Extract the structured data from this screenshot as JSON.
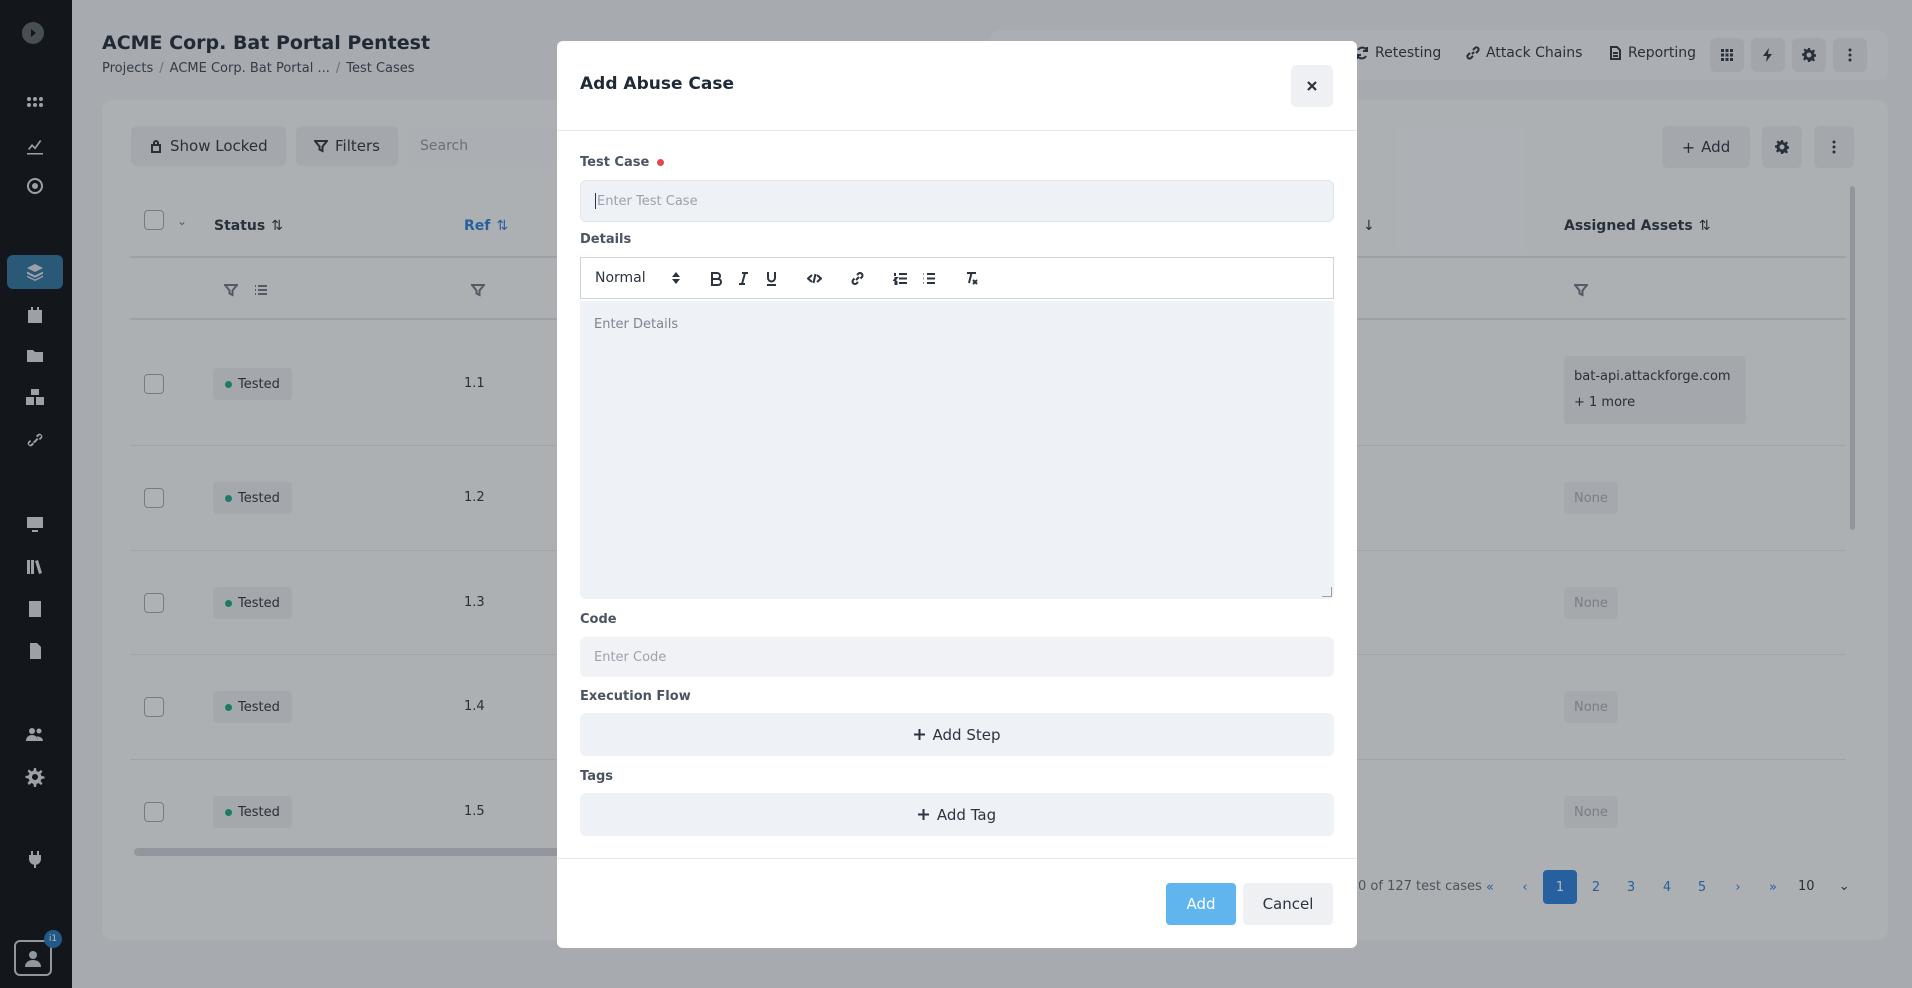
{
  "page": {
    "title": "ACME Corp. Bat Portal Pentest",
    "breadcrumb": [
      "Projects",
      "ACME Corp. Bat Portal ...",
      "Test Cases"
    ]
  },
  "topnav": {
    "retesting": "Retesting",
    "attack_chains": "Attack Chains",
    "reporting": "Reporting"
  },
  "toolbar": {
    "show_locked": "Show Locked",
    "filters": "Filters",
    "search_placeholder": "Search",
    "add": "Add"
  },
  "table": {
    "columns": {
      "status": "Status",
      "ref": "Ref",
      "assigned_assets": "Assigned Assets"
    },
    "rows": [
      {
        "status": "Tested",
        "ref": "1.1",
        "assets": [
          "bat-api.attackforge.com",
          "+ 1 more"
        ]
      },
      {
        "status": "Tested",
        "ref": "1.2",
        "assets_none": "None"
      },
      {
        "status": "Tested",
        "ref": "1.3",
        "assets_none": "None"
      },
      {
        "status": "Tested",
        "ref": "1.4",
        "assets_none": "None"
      },
      {
        "status": "Tested",
        "ref": "1.5",
        "assets_none": "None"
      }
    ]
  },
  "pagination": {
    "info": "0 of 127 test cases",
    "pages": [
      "1",
      "2",
      "3",
      "4",
      "5"
    ],
    "active_page": "1",
    "page_size": "10"
  },
  "sidebar": {
    "badge": "i1"
  },
  "modal": {
    "title": "Add Abuse Case",
    "test_case_label": "Test Case",
    "test_case_placeholder": "Enter Test Case",
    "details_label": "Details",
    "format_value": "Normal",
    "details_placeholder": "Enter Details",
    "code_label": "Code",
    "code_placeholder": "Enter Code",
    "execution_flow_label": "Execution Flow",
    "add_step": "Add Step",
    "tags_label": "Tags",
    "add_tag": "Add Tag",
    "add_button": "Add",
    "cancel_button": "Cancel"
  },
  "colors": {
    "accent": "#2a7bd3",
    "add_button": "#60b5ef",
    "sidebar_bg": "#0c0f13",
    "status_dot": "#1aa383",
    "required_dot": "#e5484d"
  }
}
